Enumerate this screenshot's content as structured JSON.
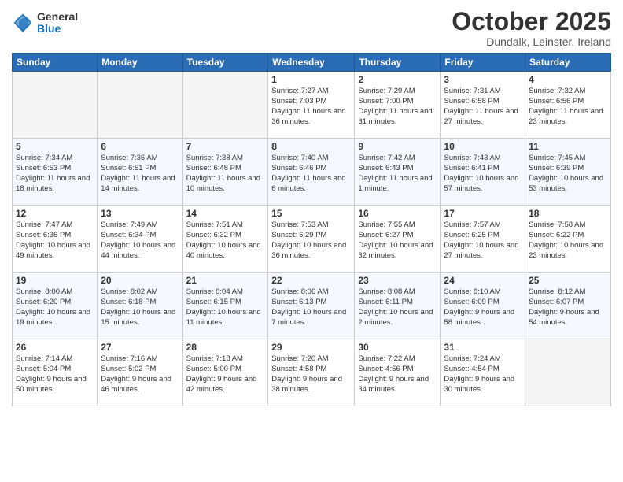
{
  "logo": {
    "general": "General",
    "blue": "Blue"
  },
  "header": {
    "month": "October 2025",
    "location": "Dundalk, Leinster, Ireland"
  },
  "weekdays": [
    "Sunday",
    "Monday",
    "Tuesday",
    "Wednesday",
    "Thursday",
    "Friday",
    "Saturday"
  ],
  "weeks": [
    [
      {
        "day": "",
        "empty": true
      },
      {
        "day": "",
        "empty": true
      },
      {
        "day": "",
        "empty": true
      },
      {
        "day": "1",
        "sunrise": "Sunrise: 7:27 AM",
        "sunset": "Sunset: 7:03 PM",
        "daylight": "Daylight: 11 hours and 36 minutes."
      },
      {
        "day": "2",
        "sunrise": "Sunrise: 7:29 AM",
        "sunset": "Sunset: 7:00 PM",
        "daylight": "Daylight: 11 hours and 31 minutes."
      },
      {
        "day": "3",
        "sunrise": "Sunrise: 7:31 AM",
        "sunset": "Sunset: 6:58 PM",
        "daylight": "Daylight: 11 hours and 27 minutes."
      },
      {
        "day": "4",
        "sunrise": "Sunrise: 7:32 AM",
        "sunset": "Sunset: 6:56 PM",
        "daylight": "Daylight: 11 hours and 23 minutes."
      }
    ],
    [
      {
        "day": "5",
        "sunrise": "Sunrise: 7:34 AM",
        "sunset": "Sunset: 6:53 PM",
        "daylight": "Daylight: 11 hours and 18 minutes."
      },
      {
        "day": "6",
        "sunrise": "Sunrise: 7:36 AM",
        "sunset": "Sunset: 6:51 PM",
        "daylight": "Daylight: 11 hours and 14 minutes."
      },
      {
        "day": "7",
        "sunrise": "Sunrise: 7:38 AM",
        "sunset": "Sunset: 6:48 PM",
        "daylight": "Daylight: 11 hours and 10 minutes."
      },
      {
        "day": "8",
        "sunrise": "Sunrise: 7:40 AM",
        "sunset": "Sunset: 6:46 PM",
        "daylight": "Daylight: 11 hours and 6 minutes."
      },
      {
        "day": "9",
        "sunrise": "Sunrise: 7:42 AM",
        "sunset": "Sunset: 6:43 PM",
        "daylight": "Daylight: 11 hours and 1 minute."
      },
      {
        "day": "10",
        "sunrise": "Sunrise: 7:43 AM",
        "sunset": "Sunset: 6:41 PM",
        "daylight": "Daylight: 10 hours and 57 minutes."
      },
      {
        "day": "11",
        "sunrise": "Sunrise: 7:45 AM",
        "sunset": "Sunset: 6:39 PM",
        "daylight": "Daylight: 10 hours and 53 minutes."
      }
    ],
    [
      {
        "day": "12",
        "sunrise": "Sunrise: 7:47 AM",
        "sunset": "Sunset: 6:36 PM",
        "daylight": "Daylight: 10 hours and 49 minutes."
      },
      {
        "day": "13",
        "sunrise": "Sunrise: 7:49 AM",
        "sunset": "Sunset: 6:34 PM",
        "daylight": "Daylight: 10 hours and 44 minutes."
      },
      {
        "day": "14",
        "sunrise": "Sunrise: 7:51 AM",
        "sunset": "Sunset: 6:32 PM",
        "daylight": "Daylight: 10 hours and 40 minutes."
      },
      {
        "day": "15",
        "sunrise": "Sunrise: 7:53 AM",
        "sunset": "Sunset: 6:29 PM",
        "daylight": "Daylight: 10 hours and 36 minutes."
      },
      {
        "day": "16",
        "sunrise": "Sunrise: 7:55 AM",
        "sunset": "Sunset: 6:27 PM",
        "daylight": "Daylight: 10 hours and 32 minutes."
      },
      {
        "day": "17",
        "sunrise": "Sunrise: 7:57 AM",
        "sunset": "Sunset: 6:25 PM",
        "daylight": "Daylight: 10 hours and 27 minutes."
      },
      {
        "day": "18",
        "sunrise": "Sunrise: 7:58 AM",
        "sunset": "Sunset: 6:22 PM",
        "daylight": "Daylight: 10 hours and 23 minutes."
      }
    ],
    [
      {
        "day": "19",
        "sunrise": "Sunrise: 8:00 AM",
        "sunset": "Sunset: 6:20 PM",
        "daylight": "Daylight: 10 hours and 19 minutes."
      },
      {
        "day": "20",
        "sunrise": "Sunrise: 8:02 AM",
        "sunset": "Sunset: 6:18 PM",
        "daylight": "Daylight: 10 hours and 15 minutes."
      },
      {
        "day": "21",
        "sunrise": "Sunrise: 8:04 AM",
        "sunset": "Sunset: 6:15 PM",
        "daylight": "Daylight: 10 hours and 11 minutes."
      },
      {
        "day": "22",
        "sunrise": "Sunrise: 8:06 AM",
        "sunset": "Sunset: 6:13 PM",
        "daylight": "Daylight: 10 hours and 7 minutes."
      },
      {
        "day": "23",
        "sunrise": "Sunrise: 8:08 AM",
        "sunset": "Sunset: 6:11 PM",
        "daylight": "Daylight: 10 hours and 2 minutes."
      },
      {
        "day": "24",
        "sunrise": "Sunrise: 8:10 AM",
        "sunset": "Sunset: 6:09 PM",
        "daylight": "Daylight: 9 hours and 58 minutes."
      },
      {
        "day": "25",
        "sunrise": "Sunrise: 8:12 AM",
        "sunset": "Sunset: 6:07 PM",
        "daylight": "Daylight: 9 hours and 54 minutes."
      }
    ],
    [
      {
        "day": "26",
        "sunrise": "Sunrise: 7:14 AM",
        "sunset": "Sunset: 5:04 PM",
        "daylight": "Daylight: 9 hours and 50 minutes."
      },
      {
        "day": "27",
        "sunrise": "Sunrise: 7:16 AM",
        "sunset": "Sunset: 5:02 PM",
        "daylight": "Daylight: 9 hours and 46 minutes."
      },
      {
        "day": "28",
        "sunrise": "Sunrise: 7:18 AM",
        "sunset": "Sunset: 5:00 PM",
        "daylight": "Daylight: 9 hours and 42 minutes."
      },
      {
        "day": "29",
        "sunrise": "Sunrise: 7:20 AM",
        "sunset": "Sunset: 4:58 PM",
        "daylight": "Daylight: 9 hours and 38 minutes."
      },
      {
        "day": "30",
        "sunrise": "Sunrise: 7:22 AM",
        "sunset": "Sunset: 4:56 PM",
        "daylight": "Daylight: 9 hours and 34 minutes."
      },
      {
        "day": "31",
        "sunrise": "Sunrise: 7:24 AM",
        "sunset": "Sunset: 4:54 PM",
        "daylight": "Daylight: 9 hours and 30 minutes."
      },
      {
        "day": "",
        "empty": true
      }
    ]
  ]
}
